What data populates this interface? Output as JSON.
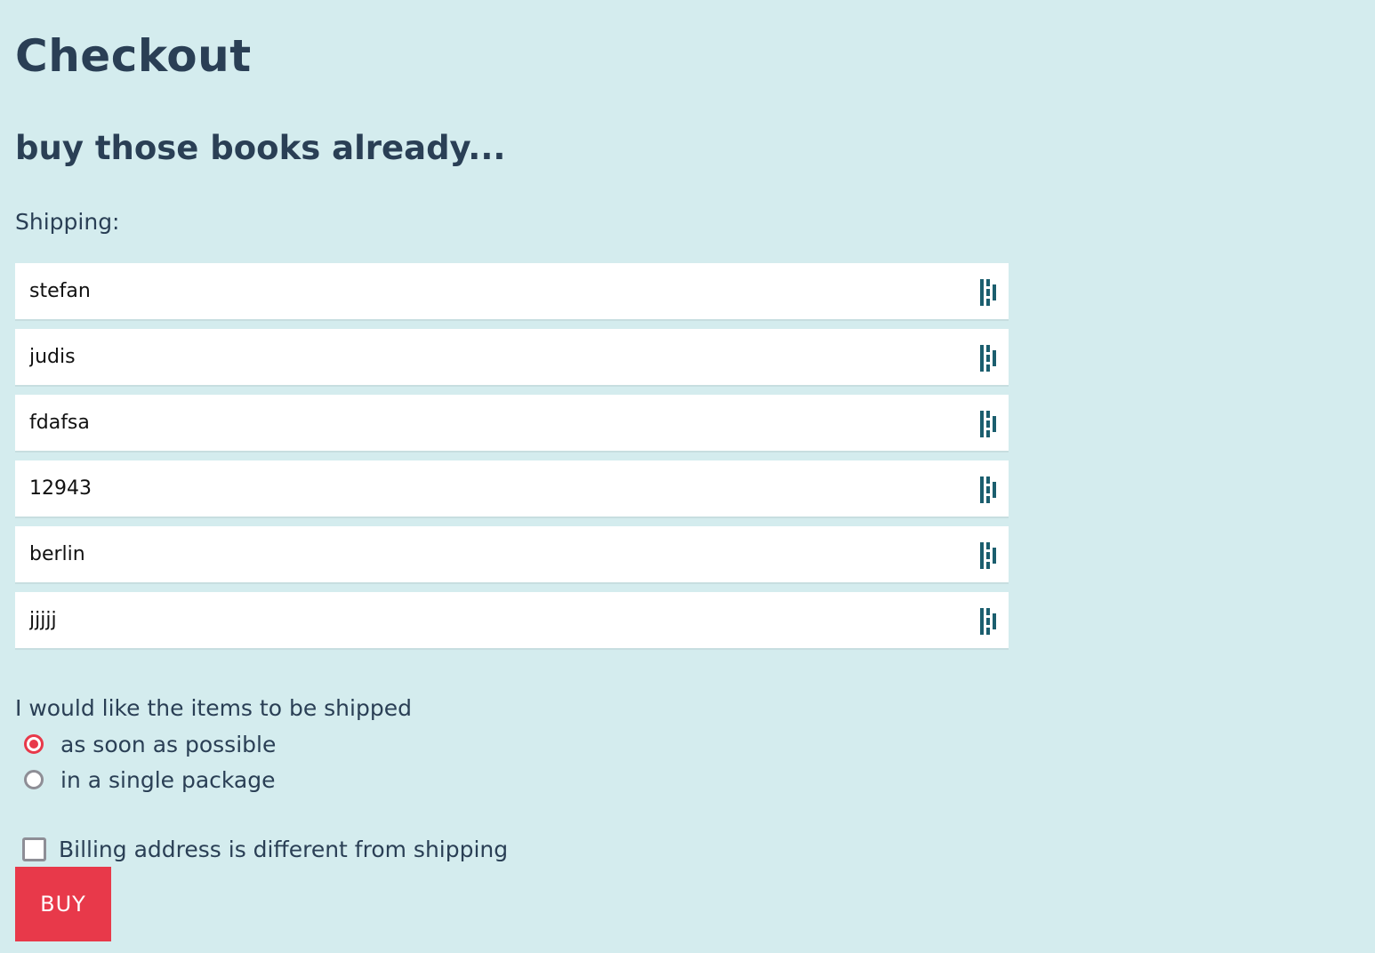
{
  "page": {
    "title": "Checkout",
    "subtitle": "buy those books already...",
    "shipping_label": "Shipping:"
  },
  "shipping_fields": [
    {
      "value": "stefan"
    },
    {
      "value": "judis"
    },
    {
      "value": "fdafsa"
    },
    {
      "value": "12943"
    },
    {
      "value": "berlin"
    },
    {
      "value": "jjjjj"
    }
  ],
  "shipping_option": {
    "question": "I would like the items to be shipped",
    "options": [
      {
        "label": "as soon as possible",
        "selected": true
      },
      {
        "label": "in a single package",
        "selected": false
      }
    ]
  },
  "billing": {
    "checkbox_label": "Billing address is different from shipping",
    "checked": false
  },
  "actions": {
    "buy_label": "BUY"
  },
  "icons": {
    "field_icon": "password-manager-icon"
  },
  "colors": {
    "background": "#d4ecee",
    "text": "#2a3f55",
    "accent": "#e8394a",
    "icon": "#1b5e6e"
  }
}
